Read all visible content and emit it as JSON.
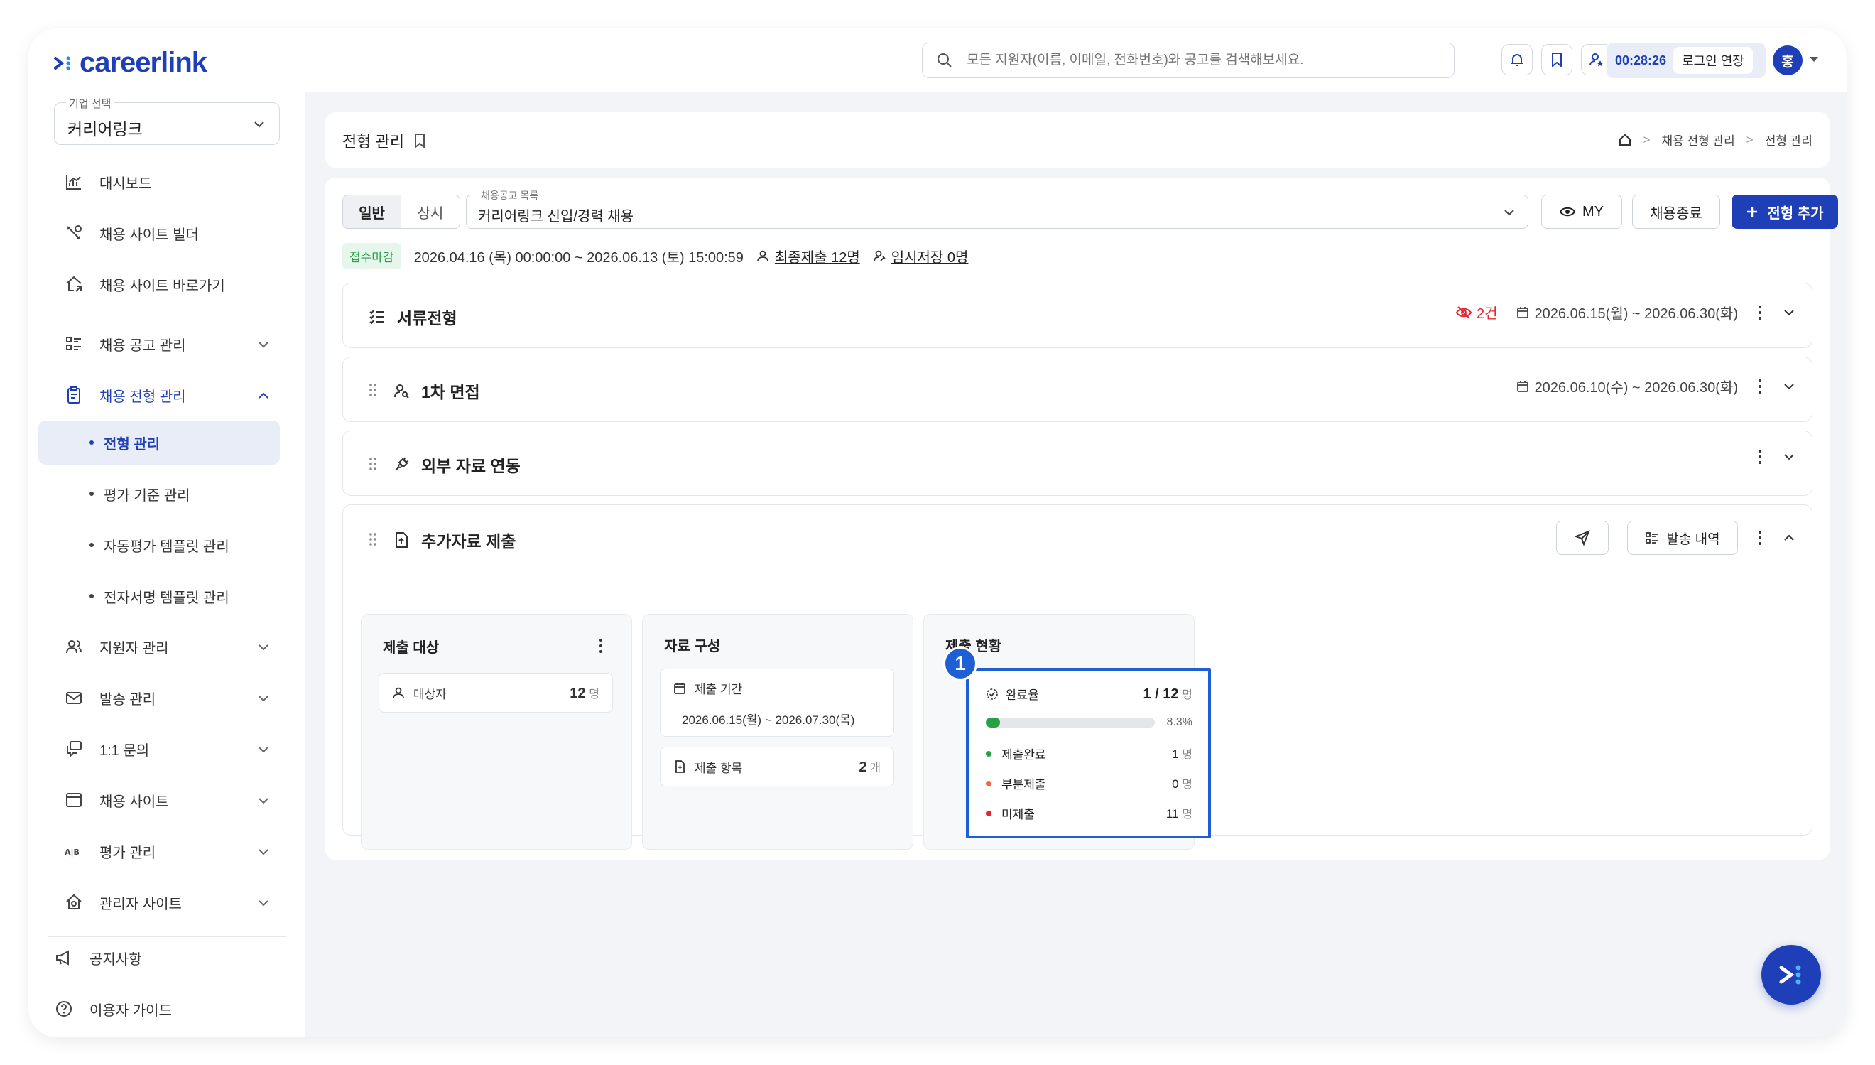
{
  "app": {
    "logo_text": "careerlink",
    "brand_color": "#1f3fb8"
  },
  "header": {
    "search_placeholder": "모든 지원자(이름, 이메일, 전화번호)와 공고를 검색해보세요.",
    "timer": "00:28:26",
    "extend_label": "로그인 연장",
    "avatar_initial": "홍",
    "icons": [
      "bell-icon",
      "bookmark-icon",
      "user-star-icon"
    ]
  },
  "sidebar": {
    "company_label": "기업 선택",
    "company_value": "커리어링크",
    "items": [
      {
        "label": "대시보드",
        "icon": "chart-icon"
      },
      {
        "label": "채용 사이트 빌더",
        "icon": "tools-icon"
      },
      {
        "label": "채용 사이트 바로가기",
        "icon": "home-link-icon"
      },
      {
        "label": "채용 공고 관리",
        "icon": "list-icon"
      },
      {
        "label": "채용 전형 관리",
        "icon": "clipboard-icon"
      },
      {
        "label": "지원자 관리",
        "icon": "users-icon"
      },
      {
        "label": "발송 관리",
        "icon": "mail-icon"
      },
      {
        "label": "1:1 문의",
        "icon": "chat-icon"
      },
      {
        "label": "채용 사이트",
        "icon": "window-icon"
      },
      {
        "label": "평가 관리",
        "icon": "ab-icon"
      },
      {
        "label": "관리자 사이트",
        "icon": "admin-home-icon"
      }
    ],
    "subitems": [
      {
        "label": "전형 관리",
        "active": true
      },
      {
        "label": "평가 기준 관리"
      },
      {
        "label": "자동평가 템플릿 관리"
      },
      {
        "label": "전자서명 템플릿 관리"
      }
    ],
    "footer": [
      {
        "label": "공지사항",
        "icon": "megaphone-icon"
      },
      {
        "label": "이용자 가이드",
        "icon": "help-icon"
      }
    ]
  },
  "page": {
    "title": "전형 관리",
    "breadcrumb": [
      "채용 전형 관리",
      "전형 관리"
    ]
  },
  "toolbar": {
    "tabs": [
      "일반",
      "상시"
    ],
    "job_select_label": "채용공고 목록",
    "job_select_value": "커리어링크 신입/경력 채용",
    "my_label": "MY",
    "close_label": "채용종료",
    "add_label": "전형 추가"
  },
  "status": {
    "badge": "접수마감",
    "period": "2026.04.16 (목) 00:00:00 ~ 2026.06.13 (토) 15:00:59",
    "final_submit": "최종제출 12명",
    "temp_save": "임시저장 0명"
  },
  "stages": [
    {
      "title": "서류전형",
      "hidden_count": "2건",
      "period": "2026.06.15(월) ~ 2026.06.30(화)"
    },
    {
      "title": "1차 면접",
      "period": "2026.06.10(수) ~ 2026.06.30(화)"
    },
    {
      "title": "외부 자료 연동"
    },
    {
      "title": "추가자료 제출",
      "history_label": "발송 내역"
    }
  ],
  "submission": {
    "target_title": "제출 대상",
    "target_label": "대상자",
    "target_count": "12",
    "unit_person": "명",
    "material_title": "자료 구성",
    "period_label": "제출 기간",
    "period_value": "2026.06.15(월) ~ 2026.07.30(목)",
    "items_label": "제출 항목",
    "items_count": "2",
    "unit_item": "개",
    "status_title": "제출 현황",
    "callout_number": "1",
    "rate_label": "완료율",
    "rate_value": "1 / 12",
    "rate_percent": "8.3%",
    "rate_fraction": 0.083,
    "rows": [
      {
        "label": "제출완료",
        "count": "1",
        "color": "#27a046"
      },
      {
        "label": "부분제출",
        "count": "0",
        "color": "#f06b3b"
      },
      {
        "label": "미제출",
        "count": "11",
        "color": "#e5242c"
      }
    ]
  }
}
